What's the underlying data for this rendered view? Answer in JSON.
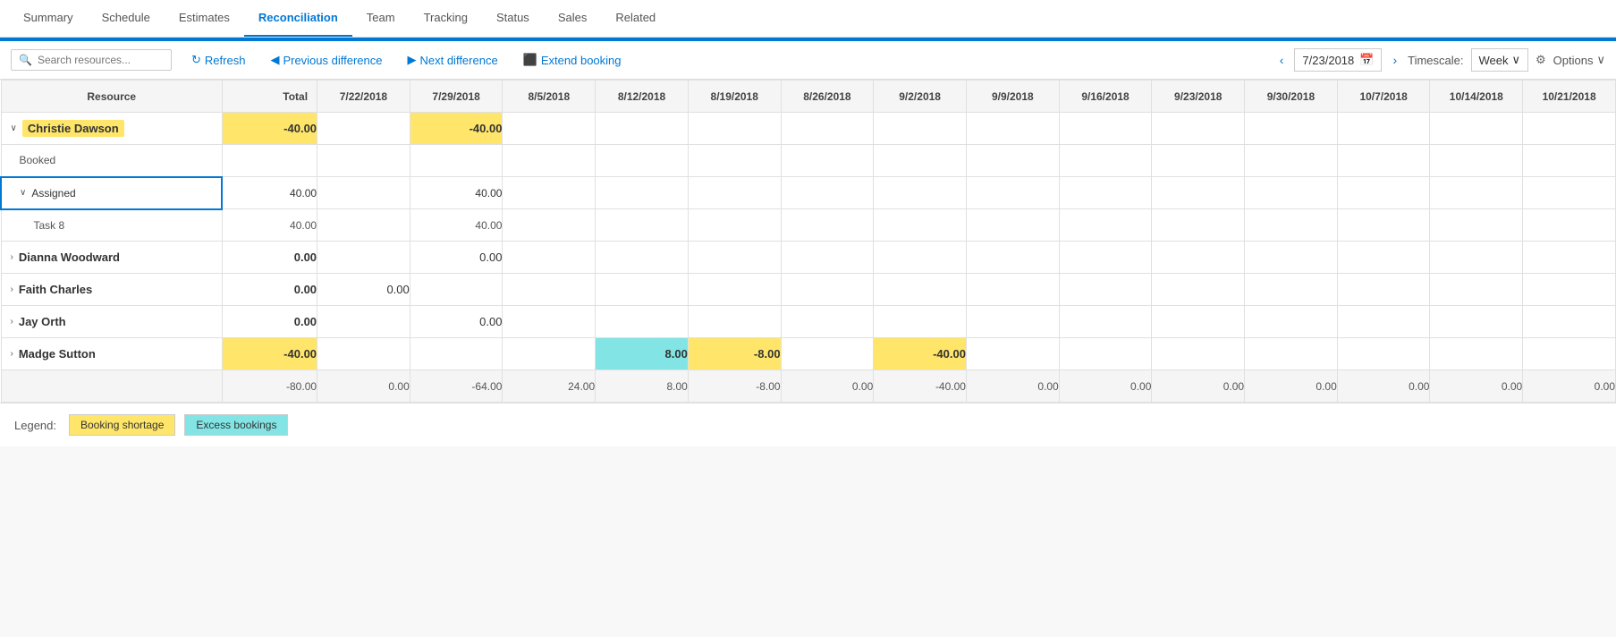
{
  "nav": {
    "tabs": [
      {
        "label": "Summary",
        "active": false
      },
      {
        "label": "Schedule",
        "active": false
      },
      {
        "label": "Estimates",
        "active": false
      },
      {
        "label": "Reconciliation",
        "active": true
      },
      {
        "label": "Team",
        "active": false
      },
      {
        "label": "Tracking",
        "active": false
      },
      {
        "label": "Status",
        "active": false
      },
      {
        "label": "Sales",
        "active": false
      },
      {
        "label": "Related",
        "active": false
      }
    ]
  },
  "toolbar": {
    "search_placeholder": "Search resources...",
    "refresh_label": "Refresh",
    "prev_diff_label": "Previous difference",
    "next_diff_label": "Next difference",
    "extend_booking_label": "Extend booking",
    "date_value": "7/23/2018",
    "timescale_label": "Timescale:",
    "timescale_value": "Week",
    "options_label": "Options"
  },
  "grid": {
    "headers": [
      "Resource",
      "Total",
      "7/22/2018",
      "7/29/2018",
      "8/5/2018",
      "8/12/2018",
      "8/19/2018",
      "8/26/2018",
      "9/2/2018",
      "9/9/2018",
      "9/16/2018",
      "9/23/2018",
      "9/30/2018",
      "10/7/2018",
      "10/14/2018",
      "10/21/2018"
    ],
    "rows": [
      {
        "type": "resource",
        "name": "Christie Dawson",
        "highlight": true,
        "expand": true,
        "values": [
          "",
          "-40.00",
          "",
          "-40.00",
          "",
          "",
          "",
          "",
          "",
          "",
          "",
          "",
          "",
          "",
          "",
          ""
        ],
        "yellow_cols": [
          1,
          3
        ]
      },
      {
        "type": "booked",
        "name": "Booked",
        "indent": 1,
        "values": [
          "",
          "",
          "",
          "",
          "",
          "",
          "",
          "",
          "",
          "",
          "",
          "",
          "",
          "",
          "",
          ""
        ]
      },
      {
        "type": "assigned",
        "name": "Assigned",
        "indent": 1,
        "expand": true,
        "values": [
          "",
          "40.00",
          "",
          "40.00",
          "",
          "",
          "",
          "",
          "",
          "",
          "",
          "",
          "",
          "",
          "",
          ""
        ]
      },
      {
        "type": "task",
        "name": "Task 8",
        "indent": 2,
        "values": [
          "",
          "40.00",
          "",
          "40.00",
          "",
          "",
          "",
          "",
          "",
          "",
          "",
          "",
          "",
          "",
          "",
          ""
        ]
      },
      {
        "type": "resource",
        "name": "Dianna Woodward",
        "highlight": false,
        "expand": false,
        "values": [
          "",
          "0.00",
          "",
          "0.00",
          "",
          "",
          "",
          "",
          "",
          "",
          "",
          "",
          "",
          "",
          "",
          ""
        ]
      },
      {
        "type": "resource",
        "name": "Faith Charles",
        "highlight": false,
        "expand": false,
        "values": [
          "",
          "0.00",
          "0.00",
          "",
          "",
          "",
          "",
          "",
          "",
          "",
          "",
          "",
          "",
          "",
          "",
          ""
        ]
      },
      {
        "type": "resource",
        "name": "Jay Orth",
        "highlight": false,
        "expand": false,
        "values": [
          "",
          "0.00",
          "",
          "0.00",
          "",
          "",
          "",
          "",
          "",
          "",
          "",
          "",
          "",
          "",
          "",
          ""
        ]
      },
      {
        "type": "resource",
        "name": "Madge Sutton",
        "highlight": false,
        "expand": false,
        "values": [
          "",
          "-40.00",
          "",
          "",
          "",
          "8.00",
          "-8.00",
          "",
          "-40.00",
          "",
          "",
          "",
          "",
          "",
          "",
          ""
        ],
        "yellow_cols": [
          1,
          6,
          8
        ],
        "cyan_cols": [
          5
        ]
      }
    ],
    "totals": [
      "-80.00",
      "0.00",
      "-64.00",
      "24.00",
      "8.00",
      "-8.00",
      "0.00",
      "-40.00",
      "0.00",
      "0.00",
      "0.00",
      "0.00",
      "0.00",
      "0.00",
      "0.00"
    ]
  },
  "legend": {
    "label": "Legend:",
    "items": [
      {
        "label": "Booking shortage",
        "type": "yellow"
      },
      {
        "label": "Excess bookings",
        "type": "cyan"
      }
    ]
  }
}
